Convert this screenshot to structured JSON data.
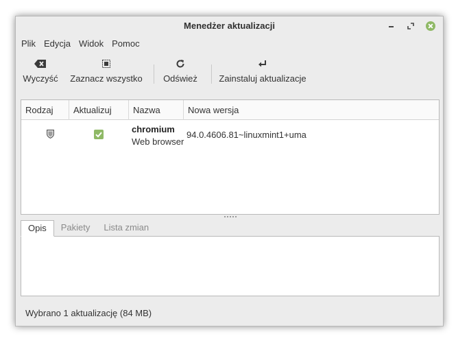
{
  "window": {
    "title": "Menedżer aktualizacji",
    "controls": [
      "minimize-icon",
      "maximize-icon",
      "close-icon"
    ],
    "close_color": "#8fb966"
  },
  "menubar": {
    "items": [
      "Plik",
      "Edycja",
      "Widok",
      "Pomoc"
    ]
  },
  "toolbar": {
    "clear": {
      "label": "Wyczyść",
      "icon": "clear-icon"
    },
    "select_all": {
      "label": "Zaznacz wszystko",
      "icon": "select-all-icon"
    },
    "refresh": {
      "label": "Odśwież",
      "icon": "refresh-icon"
    },
    "install": {
      "label": "Zainstaluj aktualizacje",
      "icon": "install-icon"
    }
  },
  "table": {
    "columns": [
      "Rodzaj",
      "Aktualizuj",
      "Nazwa",
      "Nowa wersja"
    ],
    "rows": [
      {
        "type_icon": "shield-icon",
        "checked": true,
        "name": "chromium",
        "description": "Web browser",
        "new_version": "94.0.4606.81~linuxmint1+uma"
      }
    ]
  },
  "tabs": {
    "items": [
      "Opis",
      "Pakiety",
      "Lista zmian"
    ],
    "active": "Opis"
  },
  "statusbar": {
    "text": "Wybrano 1 aktualizację (84 MB)"
  },
  "colors": {
    "accent_green": "#8fb966",
    "window_bg": "#ececec"
  }
}
